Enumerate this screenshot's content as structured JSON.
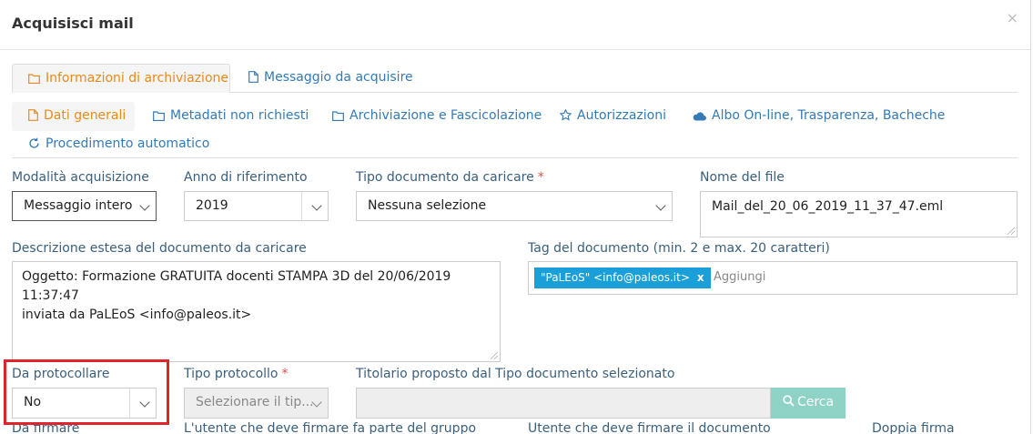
{
  "modal": {
    "title": "Acquisisci mail",
    "close": "×"
  },
  "tabs_main": [
    {
      "label": "Informazioni di archiviazione",
      "icon": "folder-icon",
      "active": true
    },
    {
      "label": "Messaggio da acquisire",
      "icon": "file-icon",
      "active": false
    }
  ],
  "tabs_sub": [
    {
      "label": "Dati generali",
      "icon": "file-icon",
      "active": true
    },
    {
      "label": "Metadati non richiesti",
      "icon": "folder-icon"
    },
    {
      "label": "Archiviazione e Fascicolazione",
      "icon": "folder-icon"
    },
    {
      "label": "Autorizzazioni",
      "icon": "star-icon"
    },
    {
      "label": "Albo On-line, Trasparenza, Bacheche",
      "icon": "cloud-icon"
    },
    {
      "label": "Procedimento automatico",
      "icon": "refresh-icon"
    }
  ],
  "form": {
    "modalita": {
      "label": "Modalità acquisizione",
      "value": "Messaggio intero"
    },
    "anno": {
      "label": "Anno di riferimento",
      "value": "2019"
    },
    "tipo_documento": {
      "label": "Tipo documento da caricare",
      "required": "*",
      "value": "Nessuna selezione"
    },
    "nome_file": {
      "label": "Nome del file",
      "value": "Mail_del_20_06_2019_11_37_47.eml"
    },
    "descrizione": {
      "label": "Descrizione estesa del documento da caricare",
      "line1": "Oggetto: Formazione GRATUITA docenti STAMPA 3D del 20/06/2019 11:37:47",
      "line2": "inviata da PaLEoS <info@paleos.it>"
    },
    "tag": {
      "label": "Tag del documento (min. 2 e max. 20 caratteri)",
      "chip": "\"PaLEoS\" <info@paleos.it>",
      "chip_remove": "x",
      "placeholder": "Aggiungi"
    },
    "da_protocollare": {
      "label": "Da protocollare",
      "value": "No"
    },
    "tipo_protocollo": {
      "label": "Tipo protocollo",
      "required": "*",
      "value": "Selezionare il tip..."
    },
    "titolario": {
      "label": "Titolario proposto dal Tipo documento selezionato",
      "button": "Cerca"
    },
    "da_firmare": {
      "label": "Da firmare"
    },
    "utente_gruppo": {
      "label": "L'utente che deve firmare fa parte del gruppo"
    },
    "utente_firma": {
      "label": "Utente che deve firmare il documento"
    },
    "doppia_firma": {
      "label": "Doppia firma"
    }
  },
  "colors": {
    "accent": "#e88a1a",
    "link": "#337ab7",
    "highlight": "#e0242d",
    "tag": "#1a9fd9",
    "button": "#8fd3c6"
  }
}
